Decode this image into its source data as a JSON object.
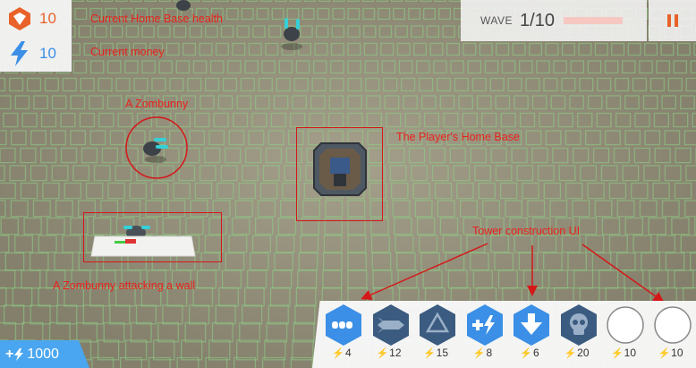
{
  "hud": {
    "health_value": "10",
    "money_value": "10",
    "wave_label": "WAVE",
    "wave_value": "1/10",
    "bank_prefix": "+",
    "bank_value": "1000"
  },
  "annotations": {
    "health": "Current Home Base health",
    "money": "Current money",
    "zombunny": "A Zombunny",
    "home_base": "The Player's Home Base",
    "tower_ui": "Tower construction UI",
    "zombunny_wall": "A Zombunny attacking a wall"
  },
  "towers": [
    {
      "icon": "triple-bullet-icon",
      "cost": "4",
      "cost_color": "blue",
      "fill": "#3b8fe6"
    },
    {
      "icon": "rocket-icon",
      "cost": "12",
      "cost_color": "red",
      "fill": "#3b5b80"
    },
    {
      "icon": "recycle-icon",
      "cost": "15",
      "cost_color": "red",
      "fill": "#3b5b80"
    },
    {
      "icon": "plus-bolt-icon",
      "cost": "8",
      "cost_color": "blue",
      "fill": "#3b8fe6"
    },
    {
      "icon": "down-arrow-icon",
      "cost": "6",
      "cost_color": "blue",
      "fill": "#3b8fe6"
    },
    {
      "icon": "skull-icon",
      "cost": "20",
      "cost_color": "red",
      "fill": "#3b5b80"
    },
    {
      "icon": "empty-slot-icon",
      "cost": "10",
      "cost_color": "blue",
      "fill": "#ffffff"
    },
    {
      "icon": "empty-slot-icon",
      "cost": "10",
      "cost_color": "blue",
      "fill": "#ffffff"
    }
  ],
  "colors": {
    "annotation_red": "#e8221c",
    "health_orange": "#e8622a",
    "money_blue": "#3b8fe6",
    "tower_dark": "#3b5b80",
    "grid_green": "#8fcf86"
  }
}
